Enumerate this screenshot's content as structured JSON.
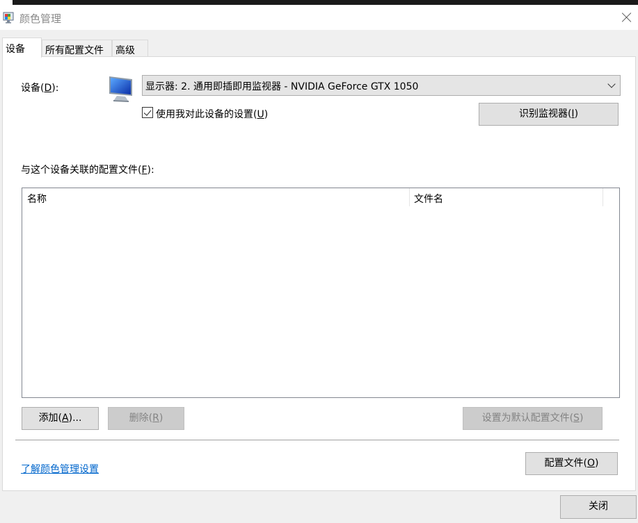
{
  "window": {
    "title": "颜色管理",
    "close_label": "×"
  },
  "tabs": [
    {
      "label": "设备",
      "active": true
    },
    {
      "label": "所有配置文件",
      "active": false
    },
    {
      "label": "高级",
      "active": false
    }
  ],
  "device": {
    "label_prefix": "设备(",
    "label_key": "D",
    "label_suffix": "):",
    "selected_device": "显示器: 2. 通用即插即用监视器 - NVIDIA GeForce GTX 1050",
    "use_settings_prefix": "使用我对此设备的设置(",
    "use_settings_key": "U",
    "use_settings_suffix": ")",
    "use_settings_checked": true,
    "identify_prefix": "识别监视器(",
    "identify_key": "I",
    "identify_suffix": ")"
  },
  "profiles": {
    "label_prefix": "与这个设备关联的配置文件(",
    "label_key": "F",
    "label_suffix": "):",
    "columns": [
      "名称",
      "文件名"
    ],
    "rows": []
  },
  "actions": {
    "add_prefix": "添加(",
    "add_key": "A",
    "add_suffix": ")...",
    "remove_prefix": "删除(",
    "remove_key": "R",
    "remove_suffix": ")",
    "set_default_prefix": "设置为默认配置文件(",
    "set_default_key": "S",
    "set_default_suffix": ")"
  },
  "footer": {
    "link": "了解颜色管理设置",
    "profile_prefix": "配置文件(",
    "profile_key": "O",
    "profile_suffix": ")",
    "close": "关闭"
  },
  "colors": {
    "link": "#0066cc",
    "button_bg": "#e1e1e1",
    "disabled_text": "#838383"
  }
}
